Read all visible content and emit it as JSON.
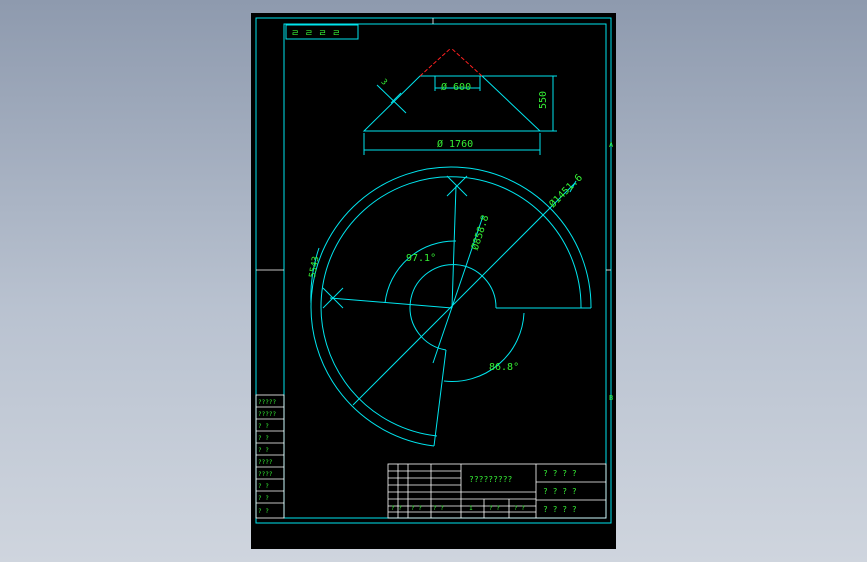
{
  "colors": {
    "background": "#8e9aae",
    "sheet": "#000000",
    "outline": "#00e5ee",
    "dimension_text": "#35f035",
    "center_line": "#ff2020"
  },
  "title_strip": {
    "text": "ㄹ ㄹ ㄹ ㄹ"
  },
  "dimensions": {
    "top_diameter": "Ø 600",
    "height": "550",
    "bottom_diameter": "Ø 1760",
    "side_mark": "3",
    "outer_diameter": "Ø1451.6",
    "inner_diameter": "Ø858.8",
    "angle_upper": "97.1°",
    "angle_lower": "86.8°",
    "arc_length": "5543"
  },
  "sheet_markers": {
    "right_top": "A",
    "right_bottom": "B"
  },
  "left_table": {
    "rows": [
      "?????",
      "?????",
      "? ?",
      "? ?",
      "? ?",
      "????",
      "????",
      "? ?",
      "? ?",
      "? ?"
    ]
  },
  "title_block": {
    "drawing_name": "?????????",
    "right_cells": [
      "? ? ? ?",
      "? ? ? ?",
      "? ? ? ?"
    ],
    "bottom_cells": [
      "? ?",
      "? ?",
      "? ?",
      "1",
      "? ?",
      "? ?"
    ]
  }
}
